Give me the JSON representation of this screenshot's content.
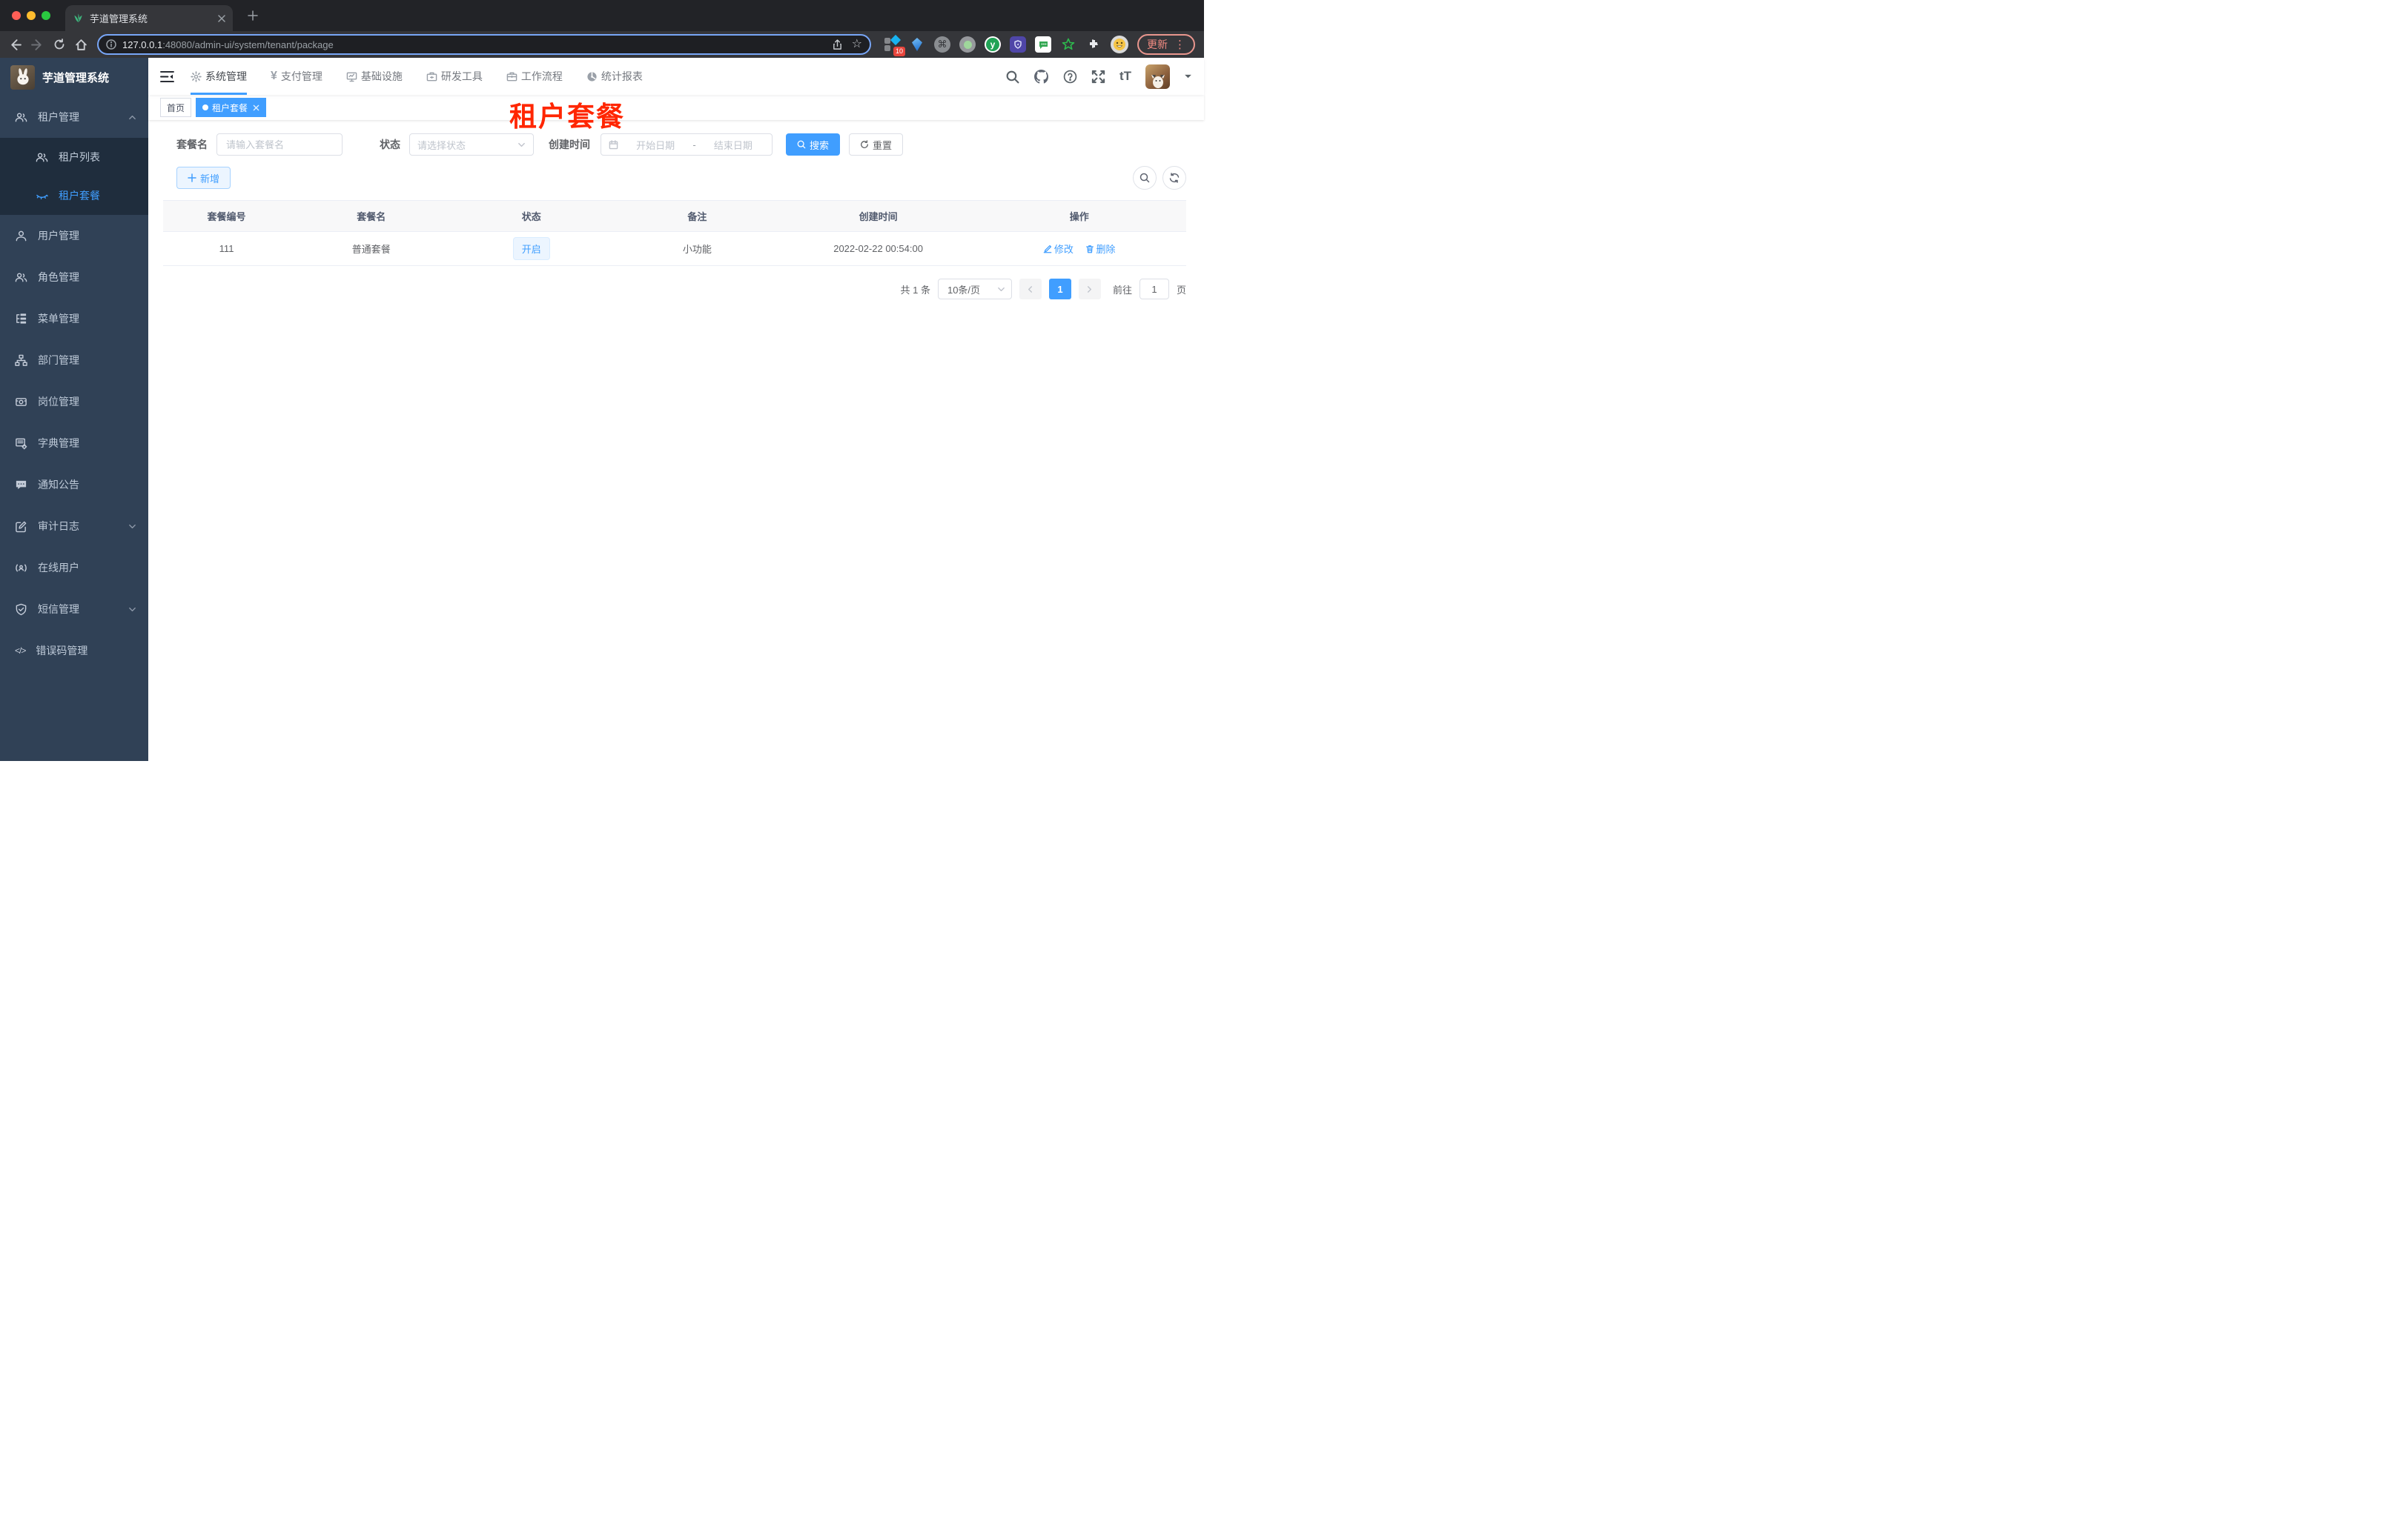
{
  "browser": {
    "tab_title": "芋道管理系统",
    "url_host": "127.0.0.1",
    "url_path": ":48080/admin-ui/system/tenant/package",
    "extension_badge": "10",
    "update_label": "更新"
  },
  "glyphs": {
    "cmd": "⌘",
    "yen": "¥",
    "font_size": "tT",
    "code": "</>",
    "dots_v": "⋮",
    "y": "y",
    "star": "☆"
  },
  "sidebar": {
    "title": "芋道管理系统",
    "items": [
      {
        "label": "租户管理"
      },
      {
        "label": "租户列表"
      },
      {
        "label": "租户套餐"
      },
      {
        "label": "用户管理"
      },
      {
        "label": "角色管理"
      },
      {
        "label": "菜单管理"
      },
      {
        "label": "部门管理"
      },
      {
        "label": "岗位管理"
      },
      {
        "label": "字典管理"
      },
      {
        "label": "通知公告"
      },
      {
        "label": "审计日志"
      },
      {
        "label": "在线用户"
      },
      {
        "label": "短信管理"
      },
      {
        "label": "错误码管理"
      }
    ]
  },
  "topnav": {
    "menus": [
      {
        "label": "系统管理"
      },
      {
        "label": "支付管理"
      },
      {
        "label": "基础设施"
      },
      {
        "label": "研发工具"
      },
      {
        "label": "工作流程"
      },
      {
        "label": "统计报表"
      }
    ]
  },
  "tags": {
    "items": [
      {
        "label": "首页"
      },
      {
        "label": "租户套餐"
      }
    ]
  },
  "annotation": {
    "text": "租户套餐"
  },
  "filters": {
    "name_label": "套餐名",
    "name_placeholder": "请输入套餐名",
    "status_label": "状态",
    "status_placeholder": "请选择状态",
    "time_label": "创建时间",
    "start_placeholder": "开始日期",
    "separator": "-",
    "end_placeholder": "结束日期",
    "search_label": "搜索",
    "reset_label": "重置"
  },
  "actions": {
    "add": "新增"
  },
  "table": {
    "headers": [
      "套餐编号",
      "套餐名",
      "状态",
      "备注",
      "创建时间",
      "操作"
    ],
    "rows": [
      {
        "id": "111",
        "name": "普通套餐",
        "status": "开启",
        "remark": "小功能",
        "create_time": "2022-02-22 00:54:00",
        "edit": "修改",
        "remove": "删除"
      }
    ]
  },
  "pagination": {
    "total": "共 1 条",
    "size": "10条/页",
    "page": "1",
    "goto_prefix": "前往",
    "goto_value": "1",
    "goto_suffix": "页"
  }
}
